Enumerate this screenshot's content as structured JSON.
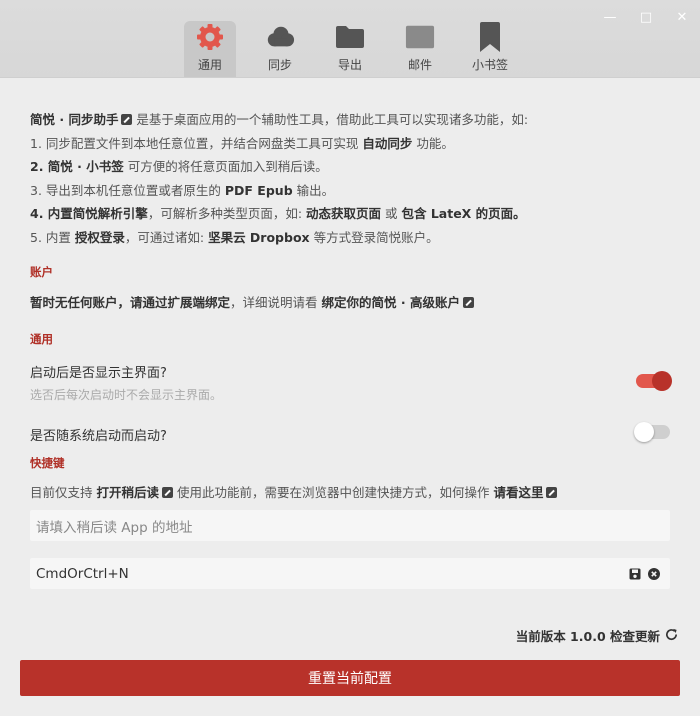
{
  "tabs": [
    {
      "label": "通用",
      "icon": "gear-icon",
      "active": true
    },
    {
      "label": "同步",
      "icon": "cloud-icon"
    },
    {
      "label": "导出",
      "icon": "folder-icon"
    },
    {
      "label": "邮件",
      "icon": "mail-icon"
    },
    {
      "label": "小书签",
      "icon": "bookmark-icon"
    }
  ],
  "intro": {
    "l1_b": "简悦 · 同步助手",
    "l1_t": " 是基于桌面应用的一个辅助性工具，借助此工具可以实现诸多功能，如:",
    "l2_a": "1. 同步配置文件到本地任意位置，并结合网盘类工具可实现 ",
    "l2_b": "自动同步",
    "l2_c": " 功能。",
    "l3_b": "2. 简悦 · 小书签",
    "l3_t": " 可方便的将任意页面加入到稍后读。",
    "l4_a": "3. 导出到本机任意位置或者原生的 ",
    "l4_b": "PDF Epub",
    "l4_c": " 输出。",
    "l5_b1": "4. 内置简悦解析引擎",
    "l5_t1": "，可解析多种类型页面，如: ",
    "l5_b2": "动态获取页面",
    "l5_t2": " 或 ",
    "l5_b3": "包含 LateX 的页面。",
    "l6_a": "5. 内置 ",
    "l6_b": "授权登录",
    "l6_c": "，可通过诸如: ",
    "l6_d": "坚果云 Dropbox",
    "l6_e": " 等方式登录简悦账户。"
  },
  "account": {
    "title": "账户",
    "b1": "暂时无任何账户，请通过扩展端绑定",
    "t1": "，详细说明请看 ",
    "b2": "绑定你的简悦 · 高级账户"
  },
  "general": {
    "title": "通用",
    "show_main_label": "启动后是否显示主界面?",
    "show_main_hint": "选否后每次启动时不会显示主界面。",
    "show_main_on": true,
    "autostart_label": "是否随系统启动而启动?",
    "autostart_on": false
  },
  "shortcut": {
    "title": "快捷键",
    "t1": "目前仅支持 ",
    "b1": "打开稍后读",
    "t2": " 使用此功能前，需要在浏览器中创建快捷方式，如何操作 ",
    "b2": "请看这里",
    "input_placeholder": "请填入稍后读 App 的地址",
    "hotkey_value": "CmdOrCtrl+N"
  },
  "footer": {
    "version_text": "当前版本 1.0.0 检查更新",
    "reset_label": "重置当前配置"
  },
  "colors": {
    "accent": "#b8322a",
    "background": "#ededed"
  }
}
